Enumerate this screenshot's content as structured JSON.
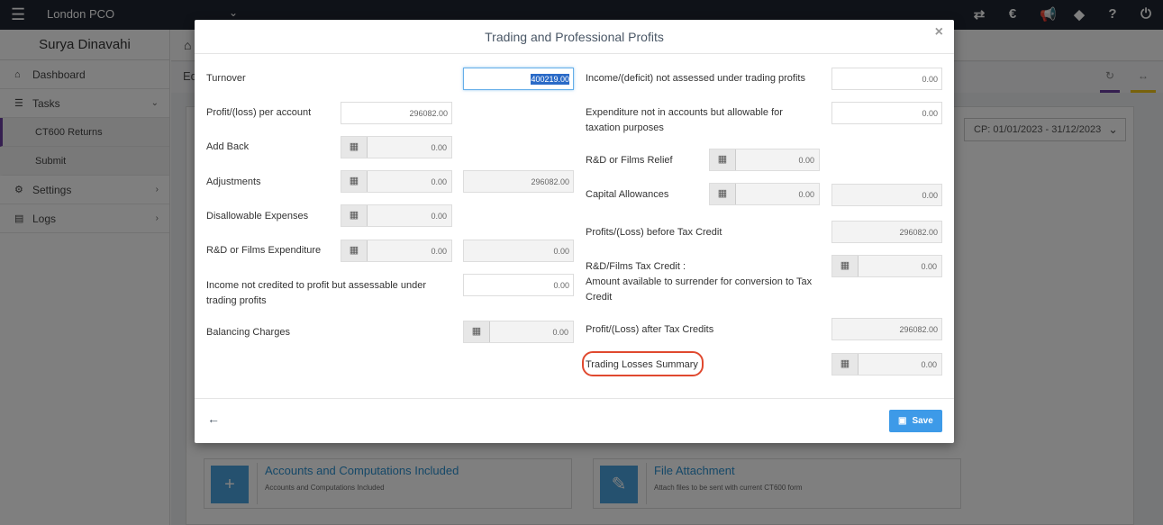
{
  "topbar": {
    "org_name": "London PCO",
    "icons": [
      "swap-icon",
      "euro-icon",
      "megaphone-icon",
      "ticket-icon",
      "help-icon",
      "power-icon"
    ]
  },
  "sidebar": {
    "user_name": "Surya Dinavahi",
    "items": [
      {
        "label": "Dashboard"
      },
      {
        "label": "Tasks"
      },
      {
        "label": "CT600 Returns"
      },
      {
        "label": "Submit"
      },
      {
        "label": "Settings"
      },
      {
        "label": "Logs"
      }
    ]
  },
  "subbar": {
    "edit_prefix": "Ed"
  },
  "period_select": "CP: 01/01/2023 - 31/12/2023",
  "cards": [
    {
      "title": "Accounts and Computations Included",
      "subtitle": "Accounts and Computations Included",
      "icon": "plus-icon"
    },
    {
      "title": "File Attachment",
      "subtitle": "Attach files to be sent with current CT600 form",
      "icon": "paperclip-icon"
    }
  ],
  "modal": {
    "title": "Trading and Professional Profits",
    "close": "×",
    "save_label": "Save",
    "left": {
      "turnover": {
        "label": "Turnover",
        "value": "400219.00"
      },
      "profit_per_account": {
        "label": "Profit/(loss) per account",
        "value": "296082.00"
      },
      "add_back": {
        "label": "Add Back",
        "value": "0.00"
      },
      "adjustments": {
        "label": "Adjustments",
        "value": "0.00",
        "total": "296082.00"
      },
      "disallowable": {
        "label": "Disallowable Expenses",
        "value": "0.00"
      },
      "rd_expenditure": {
        "label": "R&D or Films Expenditure",
        "value": "0.00",
        "total": "0.00"
      },
      "income_not_credited": {
        "label": "Income not credited to profit but assessable under trading profits",
        "value": "0.00"
      },
      "balancing_charges": {
        "label": "Balancing Charges",
        "value": "0.00"
      }
    },
    "right": {
      "income_not_assessed": {
        "label": "Income/(deficit) not assessed under trading profits",
        "value": "0.00"
      },
      "expenditure_allowable": {
        "label": "Expenditure not in accounts but allowable for taxation purposes",
        "value": "0.00"
      },
      "rd_relief": {
        "label": "R&D or Films Relief",
        "value": "0.00"
      },
      "capital_allowances": {
        "label": "Capital Allowances",
        "value": "0.00",
        "total": "0.00"
      },
      "profits_before_credit": {
        "label": "Profits/(Loss) before Tax Credit",
        "value": "296082.00"
      },
      "rd_tax_credit": {
        "label": "R&D/Films Tax Credit :\nAmount available to surrender for conversion to Tax Credit",
        "value": "0.00"
      },
      "profit_after_credits": {
        "label": "Profit/(Loss) after Tax Credits",
        "value": "296082.00"
      },
      "trading_losses_summary": {
        "label": "Trading Losses Summary",
        "value": "0.00"
      }
    }
  },
  "colors": {
    "accent": "#3d9ae8",
    "highlight": "#e0492f",
    "topbar": "#1e2530"
  }
}
